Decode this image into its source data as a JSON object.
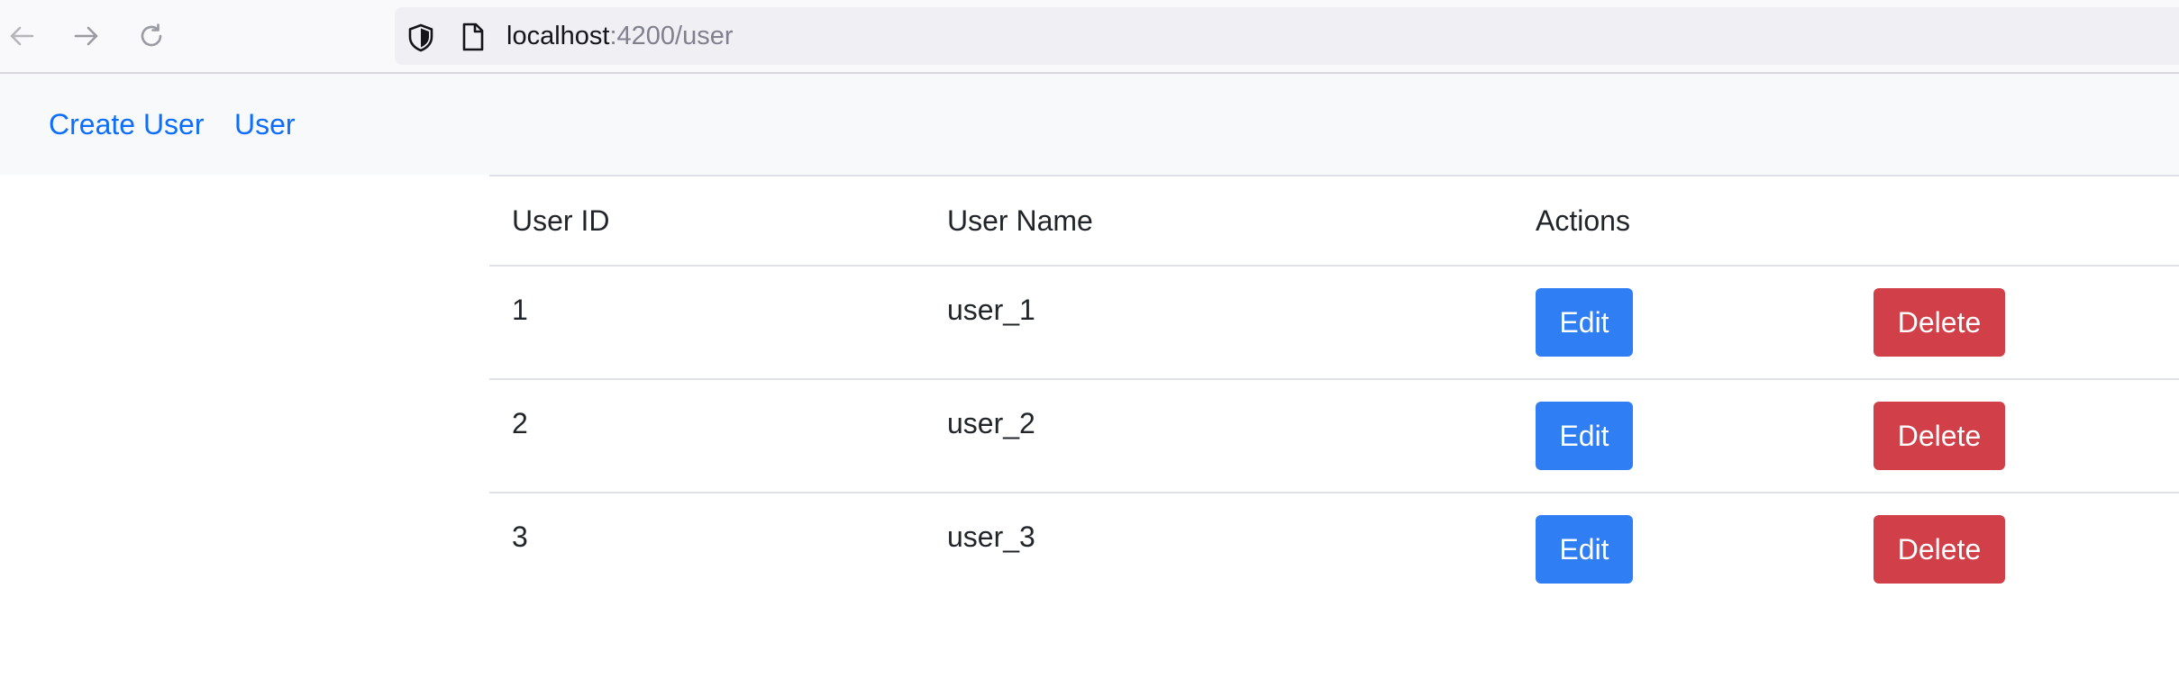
{
  "browser": {
    "url_host": "localhost",
    "url_rest": ":4200/user"
  },
  "navbar": {
    "links": [
      "Create User",
      "User"
    ]
  },
  "table": {
    "headers": [
      "User ID",
      "User Name",
      "Actions"
    ],
    "rows": [
      {
        "id": "1",
        "name": "user_1",
        "edit_label": "Edit",
        "delete_label": "Delete"
      },
      {
        "id": "2",
        "name": "user_2",
        "edit_label": "Edit",
        "delete_label": "Delete"
      },
      {
        "id": "3",
        "name": "user_3",
        "edit_label": "Edit",
        "delete_label": "Delete"
      }
    ]
  },
  "colors": {
    "link": "#0d6efd",
    "edit_button": "#2f7ef3",
    "delete_button": "#d14049",
    "navbar_bg": "#f8f9fa",
    "border": "#dee2e6"
  },
  "icons": {
    "back": "arrow-left-icon",
    "forward": "arrow-right-icon",
    "reload": "reload-icon",
    "tracking": "shield-icon",
    "page": "page-icon"
  }
}
